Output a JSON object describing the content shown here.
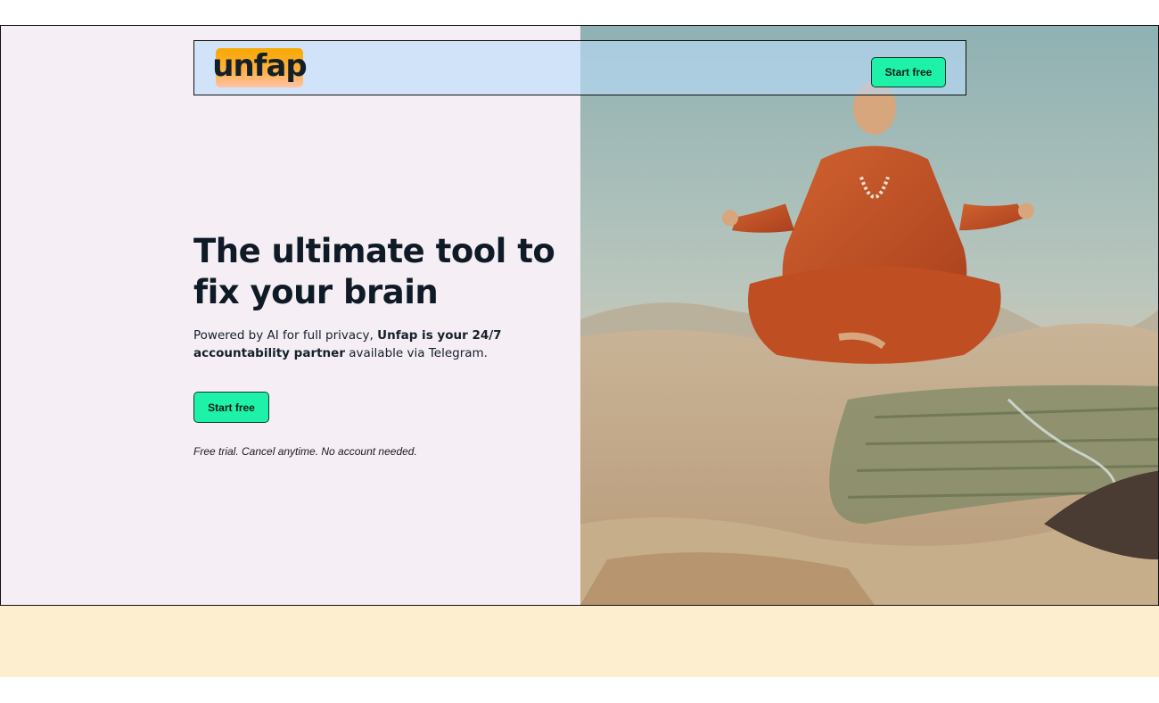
{
  "header": {
    "logo_text": "unfap",
    "cta_label": "Start free"
  },
  "hero": {
    "headline": "The ultimate tool to fix your brain",
    "subtext": {
      "part1": "Powered by AI for full privacy, ",
      "bold1": "Unfap is your 24/7 accountability partner",
      "part2": " available via Telegram."
    },
    "cta_label": "Start free",
    "note": "Free trial. Cancel anytime. No account needed."
  },
  "image": {
    "icon": "levitating-monk-image"
  },
  "colors": {
    "accent": "#1ef2a9",
    "hero_bg": "#f6eef5",
    "nav_bg": "#badcfa",
    "bottom_band": "#fdeecf",
    "logo_gradient_top": "#f7a900",
    "logo_gradient_bottom": "#ffc2a6"
  }
}
